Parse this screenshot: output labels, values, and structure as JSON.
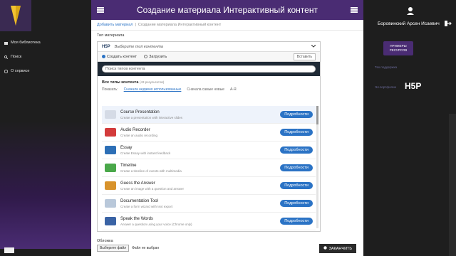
{
  "topbar": {
    "title": "Создание материала Интерактивный контент"
  },
  "breadcrumbs": {
    "link": "Добавить материал",
    "separator": "|",
    "current": "Создание материала Интерактивный контент"
  },
  "left_nav": {
    "items": [
      {
        "label": "Моя библиотека",
        "icon": "folder-icon"
      },
      {
        "label": "Поиск",
        "icon": "search-icon"
      },
      {
        "label": "О сервисе",
        "icon": "info-icon"
      }
    ]
  },
  "content_type": {
    "label": "Тип материала",
    "hub_logo": "H5P",
    "placeholder": "Выберите тип контента",
    "tab_create": "Создать контент",
    "tab_upload": "Загрузить",
    "paste": "Вставить",
    "search_placeholder": "Поиск типов контента",
    "types_title": "Все типы контента",
    "types_count": "(43 результатов)",
    "sort_label": "Показать:",
    "sort_recent": "Сначала недавно использованные",
    "sort_new": "Сначала самые новые",
    "sort_az": "А-Я",
    "details_label": "Подробности",
    "items": [
      {
        "title": "Course Presentation",
        "desc": "Create a presentation with interactive slides",
        "color": "#d5dbe6"
      },
      {
        "title": "Audio Recorder",
        "desc": "Create an audio recording",
        "color": "#d33b3b"
      },
      {
        "title": "Essay",
        "desc": "Create Essay with instant feedback",
        "color": "#2d6fb6"
      },
      {
        "title": "Timeline",
        "desc": "Create a timeline of events with multimedia",
        "color": "#4aa84a"
      },
      {
        "title": "Guess the Answer",
        "desc": "Create an image with a question and answer",
        "color": "#d8932c"
      },
      {
        "title": "Documentation Tool",
        "desc": "Create a form wizard with text export",
        "color": "#b9c8da"
      },
      {
        "title": "Speak the Words",
        "desc": "Answer a question using your voice (Chrome only)",
        "color": "#3a63a5"
      }
    ]
  },
  "cover": {
    "label": "Обложка",
    "file_button": "Выберите файл",
    "file_status": "Файл не выбран"
  },
  "save_button": "ЗАКАНЧИТЬ",
  "right_panel": {
    "user_name": "Боровинский Арсен Исаевич",
    "examples_button": "ПРИМЕРЫ РЕСУРСОВ",
    "link1": "Тех.поддержка",
    "link2": "Эл.портфолио",
    "h5p_logo": "H5P"
  },
  "colors": {
    "accent": "#4a2c73",
    "button": "#2b73c5",
    "dark": "#1e1e1e"
  }
}
